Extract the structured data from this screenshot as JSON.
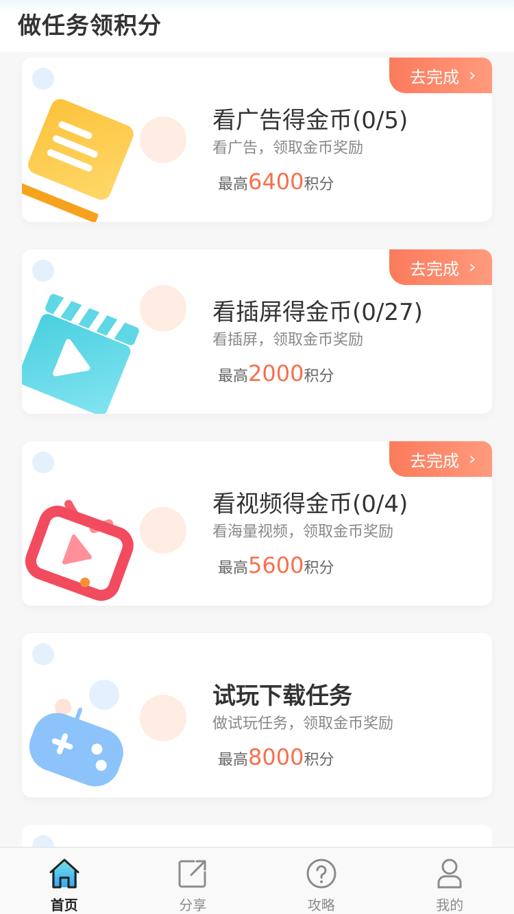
{
  "page": {
    "title": "做任务领积分"
  },
  "tasks": [
    {
      "title": "看广告得金币(0/5)",
      "desc": "看广告，领取金币奖励",
      "points_prefix": "最高",
      "points": "6400",
      "points_suffix": "积分",
      "action": "去完成",
      "icon": "document-icon"
    },
    {
      "title": "看插屏得金币(0/27)",
      "desc": "看插屏，领取金币奖励",
      "points_prefix": "最高",
      "points": "2000",
      "points_suffix": "积分",
      "action": "去完成",
      "icon": "clapperboard-icon"
    },
    {
      "title": "看视频得金币(0/4)",
      "desc": "看海量视频，领取金币奖励",
      "points_prefix": "最高",
      "points": "5600",
      "points_suffix": "积分",
      "action": "去完成",
      "icon": "tv-icon"
    },
    {
      "title": "试玩下载任务",
      "desc": "做试玩任务，领取金币奖励",
      "points_prefix": "最高",
      "points": "8000",
      "points_suffix": "积分",
      "action": "",
      "icon": "gamepad-icon"
    }
  ],
  "tabbar": {
    "items": [
      {
        "label": "首页",
        "icon": "home-icon",
        "active": true
      },
      {
        "label": "分享",
        "icon": "share-icon",
        "active": false
      },
      {
        "label": "攻略",
        "icon": "help-icon",
        "active": false
      },
      {
        "label": "我的",
        "icon": "user-icon",
        "active": false
      }
    ]
  },
  "colors": {
    "accent": "#f86e4c",
    "badge_start": "#fb7b5c",
    "badge_end": "#ff9a7c"
  }
}
